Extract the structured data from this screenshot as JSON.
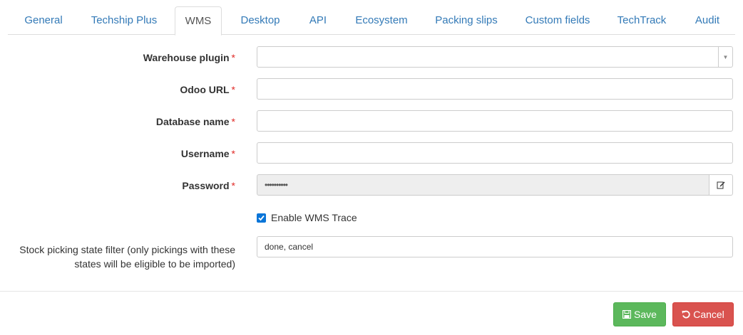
{
  "tabs": [
    {
      "label": "General"
    },
    {
      "label": "Techship Plus"
    },
    {
      "label": "WMS"
    },
    {
      "label": "Desktop"
    },
    {
      "label": "API"
    },
    {
      "label": "Ecosystem"
    },
    {
      "label": "Packing slips"
    },
    {
      "label": "Custom fields"
    },
    {
      "label": "TechTrack"
    },
    {
      "label": "Audit"
    }
  ],
  "active_tab": "WMS",
  "form": {
    "warehouse_plugin": {
      "label": "Warehouse plugin",
      "value": ""
    },
    "odoo_url": {
      "label": "Odoo URL",
      "value": ""
    },
    "database_name": {
      "label": "Database name",
      "value": ""
    },
    "username": {
      "label": "Username",
      "value": ""
    },
    "password": {
      "label": "Password",
      "value": "••••••••••"
    },
    "required_marker": "*",
    "enable_wms_trace": {
      "label": "Enable WMS Trace",
      "checked": true
    },
    "stock_filter": {
      "label_line1": "Stock picking state filter (only pickings with these",
      "label_line2": "states will be eligible to be imported)",
      "value": "done, cancel"
    }
  },
  "actions": {
    "save_label": "Save",
    "cancel_label": "Cancel"
  },
  "colors": {
    "link": "#337ab7",
    "required": "#e02b27",
    "save": "#5cb85c",
    "cancel": "#d9534f",
    "checkbox": "#0a75d8"
  },
  "icons": {
    "select": "chevron-down-icon",
    "password_edit": "edit-icon",
    "save": "save-icon",
    "cancel": "undo-icon"
  }
}
